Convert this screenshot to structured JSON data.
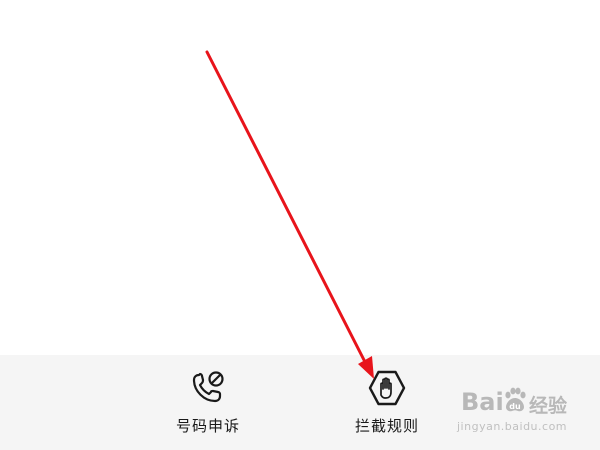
{
  "bottom_bar": {
    "items": [
      {
        "label": "号码申诉",
        "icon": "phone-blocked-icon"
      },
      {
        "label": "拦截规则",
        "icon": "hand-stop-icon"
      }
    ]
  },
  "annotation": {
    "color": "#e8141b",
    "icon": "red-arrow-pointer"
  },
  "watermark": {
    "brand": "Bai",
    "brand_suffix": "经验",
    "url": "jingyan.baidu.com"
  },
  "colors": {
    "background": "#ffffff",
    "bottom_bar_background": "#f5f5f5",
    "text": "#1a1a1a"
  }
}
